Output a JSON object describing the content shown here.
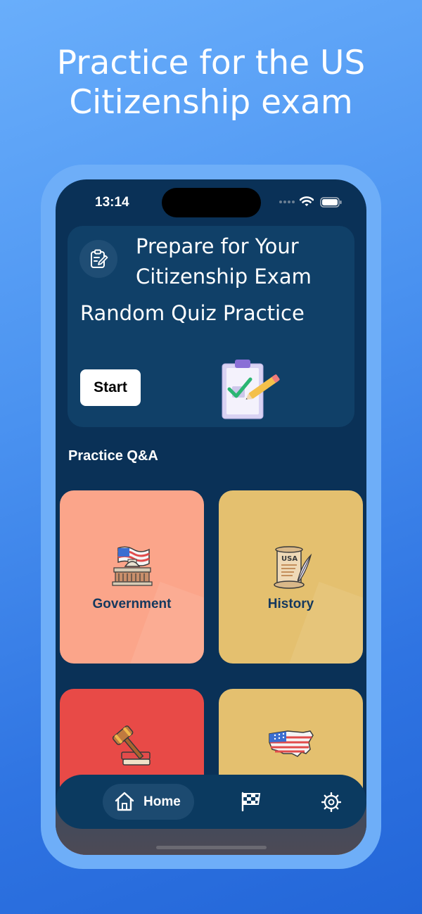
{
  "headline": {
    "line1": "Practice for the US",
    "line2": "Citizenship exam"
  },
  "status_bar": {
    "time": "13:14",
    "icons": [
      "cellular-dots-icon",
      "wifi-icon",
      "battery-icon"
    ]
  },
  "hero": {
    "icon": "clipboard-edit-icon",
    "title_line1": "Prepare for Your",
    "title_line2": "Citizenship Exam",
    "subtitle": "Random Quiz Practice",
    "start_label": "Start",
    "illustration": "clipboard-checkmark-pencil"
  },
  "section_title": "Practice Q&A",
  "categories": [
    {
      "label": "Government",
      "icon": "capitol-flag-icon",
      "color": "#fba58a"
    },
    {
      "label": "History",
      "icon": "scroll-quill-icon",
      "color": "#e4c06f"
    },
    {
      "label": "",
      "icon": "gavel-book-icon",
      "color": "#e84a47"
    },
    {
      "label": "",
      "icon": "usa-map-flag-icon",
      "color": "#e4c06f"
    }
  ],
  "tab_bar": {
    "items": [
      {
        "label": "Home",
        "icon": "home-icon",
        "active": true
      },
      {
        "label": "",
        "icon": "checkered-flag-icon",
        "active": false
      },
      {
        "label": "",
        "icon": "gear-icon",
        "active": false
      }
    ]
  },
  "colors": {
    "background_top": "#69aefb",
    "background_bottom": "#2366d8",
    "phone_frame": "#6eaef8",
    "screen_bg": "#0a3157",
    "card_bg": "#104068",
    "tile_label": "#14385e"
  }
}
